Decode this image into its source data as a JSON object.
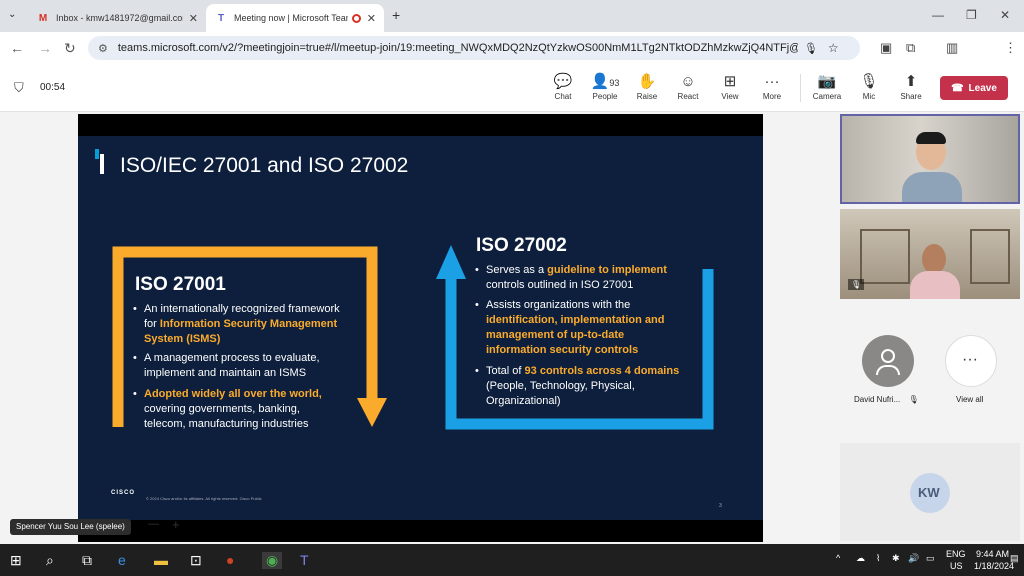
{
  "browser": {
    "tabs": [
      {
        "title": "Inbox - kmw1481972@gmail.com",
        "favicon": "gmail-icon"
      },
      {
        "title": "Meeting now | Microsoft Teams",
        "favicon": "teams-icon"
      }
    ],
    "url": "teams.microsoft.com/v2/?meetingjoin=true#/l/meetup-join/19:meeting_NWQxMDQ2NzQtYzkwOS00NmM1LTg2NTktODZhMzkwZjQ4NTFj@thread.v..."
  },
  "teams": {
    "timer": "00:54",
    "people_count": "93",
    "buttons": {
      "chat": "Chat",
      "people": "People",
      "raise": "Raise",
      "react": "React",
      "view": "View",
      "more": "More",
      "camera": "Camera",
      "mic": "Mic",
      "share": "Share",
      "leave": "Leave"
    }
  },
  "slide": {
    "title": "ISO/IEC 27001 and ISO 27002",
    "left": {
      "heading": "ISO 27001",
      "bullets": [
        {
          "pre": "An internationally recognized framework for ",
          "hl": "Information Security Management System (ISMS)",
          "post": ""
        },
        {
          "pre": "A management process to evaluate, implement and maintain an ISMS",
          "hl": "",
          "post": ""
        },
        {
          "pre": "",
          "hl": "Adopted widely all over the world,",
          "post": " covering governments, banking, telecom, manufacturing industries"
        }
      ]
    },
    "right": {
      "heading": "ISO 27002",
      "bullets": [
        {
          "pre": "Serves as a ",
          "hl": "guideline to implement",
          "post": " controls outlined in ISO 27001"
        },
        {
          "pre": "Assists organizations with the ",
          "hl": "identification, implementation and management of up-to-date information security controls",
          "post": ""
        },
        {
          "pre": "Total of ",
          "hl": "93 controls across 4 domains",
          "post": " (People, Technology, Physical, Organizational)"
        }
      ]
    },
    "footer_logo": "CISCO",
    "footer_text": "© 2024 Cisco and/or its affiliates. All rights reserved.   Cisco Public",
    "page_number": "3",
    "colors": {
      "orange": "#fbab2c",
      "blue": "#1ba0e6",
      "navy": "#0d1f3c"
    }
  },
  "participants": {
    "david": "David Nufri...",
    "view_all": "View all",
    "kw_initials": "KW"
  },
  "presenter_tag": "Spencer Yuu Sou Lee (spelee)",
  "taskbar": {
    "lang": "ENG",
    "region": "US",
    "time": "9:44 AM",
    "date": "1/18/2024"
  }
}
